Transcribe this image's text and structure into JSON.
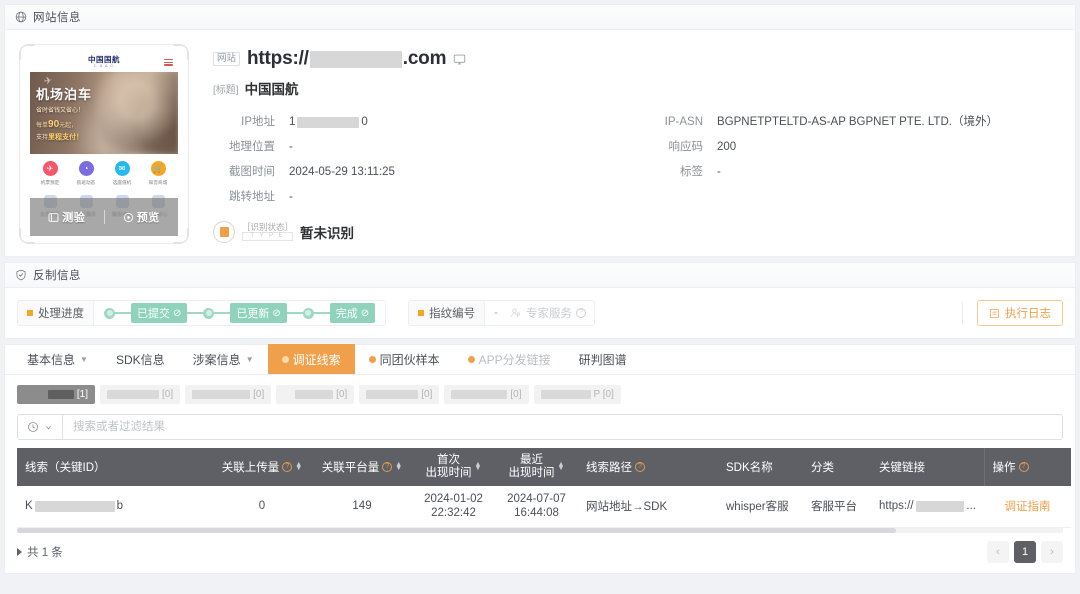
{
  "site_section": {
    "header": {
      "icon": "globe-icon",
      "title": "网站信息"
    },
    "preview": {
      "brand_cn": "中国国航",
      "brand_en": "C A A C",
      "hero_line1": "机场泊车",
      "hero_line2": "省时省钱又省心！",
      "hero_price_prefix": "每单",
      "hero_price": "90",
      "hero_price_suffix": "元起，",
      "hero_line4_prefix": "支持",
      "hero_line4_bold": "里程支付！",
      "quick_items": [
        {
          "label": "机票预定",
          "icon": "plane-icon",
          "color": "#f5566a"
        },
        {
          "label": "航班动态",
          "icon": "clock-icon",
          "color": "#7b6ce0"
        },
        {
          "label": "选座值机",
          "icon": "mail-icon",
          "color": "#29b7ef"
        },
        {
          "label": "知音商城",
          "icon": "cart-icon",
          "color": "#f5a623"
        }
      ],
      "grid_items": [
        {
          "label": "会员专区"
        },
        {
          "label": "旅行服务"
        },
        {
          "label": "服务中心"
        },
        {
          "label": "行李中心"
        }
      ],
      "overlay_buttons": [
        {
          "label": "测验",
          "icon": "scan-icon"
        },
        {
          "label": "预览",
          "icon": "eye-icon"
        }
      ]
    },
    "url_tag": "网站",
    "url_prefix": "https://",
    "url_suffix": ".com",
    "monitor_icon": "monitor-icon",
    "title_tag": "[标题]",
    "title_value": "中国国航",
    "fields_left": [
      {
        "key": "IP地址",
        "value": "1",
        "value_suffix": "0",
        "redacted": true
      },
      {
        "key": "地理位置",
        "value": "-"
      },
      {
        "key": "截图时间",
        "value": "2024-05-29 13:11:25"
      },
      {
        "key": "跳转地址",
        "value": "-"
      }
    ],
    "fields_right": [
      {
        "key": "IP-ASN",
        "value": "BGPNETPTELTD-AS-AP BGPNET PTE. LTD.（境外）"
      },
      {
        "key": "响应码",
        "value": "200"
      },
      {
        "key": "标签",
        "value": "-"
      }
    ],
    "status": {
      "tag_top": "［识别状态］",
      "tag_bottom": "T Y P E",
      "value": "暂未识别",
      "icon": "doc-badge-icon"
    }
  },
  "anti_fraud": {
    "header": {
      "icon": "shield-check-icon",
      "title": "反制信息"
    },
    "progress_label": "处理进度",
    "steps": [
      {
        "label": "已提交",
        "state": "done"
      },
      {
        "label": "已更新",
        "state": "done"
      },
      {
        "label": "完成",
        "state": "done"
      }
    ],
    "fingerprint_label": "指纹编号",
    "fingerprint_value": "-",
    "expert_label": "专家服务",
    "expert_icon": "expert-icon",
    "exec_log_label": "执行日志",
    "exec_log_icon": "log-icon"
  },
  "tabs": [
    {
      "label": "基本信息",
      "caret": true,
      "active": false,
      "muted": false
    },
    {
      "label": "SDK信息",
      "caret": false,
      "active": false,
      "muted": false
    },
    {
      "label": "涉案信息",
      "caret": true,
      "active": false,
      "muted": false
    },
    {
      "label": "调证线索",
      "caret": false,
      "active": true,
      "muted": false,
      "dot": true
    },
    {
      "label": "同团伙样本",
      "caret": false,
      "active": false,
      "muted": false,
      "dot": true
    },
    {
      "label": "APP分发链接",
      "caret": false,
      "active": false,
      "muted": true,
      "dot": true
    },
    {
      "label": "研判图谱",
      "caret": false,
      "active": false,
      "muted": false
    }
  ],
  "subtabs": [
    {
      "label": "[1]",
      "active": true,
      "blob_w": 26
    },
    {
      "label": "[0]",
      "active": false,
      "blob_w": 52
    },
    {
      "label": "[0]",
      "active": false,
      "blob_w": 58
    },
    {
      "label": "[0]",
      "active": false,
      "blob_w": 38
    },
    {
      "label": "[0]",
      "active": false,
      "blob_w": 52
    },
    {
      "label": "[0]",
      "active": false,
      "blob_w": 56
    },
    {
      "label": "P [0]",
      "active": false,
      "blob_w": 50
    }
  ],
  "search": {
    "prefix_icon": "history-icon",
    "caret_icon": "chevron-down-icon",
    "placeholder": "搜索或者过滤结果",
    "value": ""
  },
  "table": {
    "columns": [
      {
        "label": "线索（关键ID）",
        "help": false,
        "sort": false,
        "two_line": false
      },
      {
        "label": "关联上传量",
        "help": true,
        "sort": true,
        "two_line": false
      },
      {
        "label": "关联平台量",
        "help": true,
        "sort": true,
        "two_line": false
      },
      {
        "label_l1": "首次",
        "label_l2": "出现时间",
        "help": false,
        "sort": true,
        "two_line": true
      },
      {
        "label_l1": "最近",
        "label_l2": "出现时间",
        "help": false,
        "sort": true,
        "two_line": true
      },
      {
        "label": "线索路径",
        "help": true,
        "sort": false,
        "two_line": false
      },
      {
        "label": "SDK名称",
        "help": false,
        "sort": false,
        "two_line": false
      },
      {
        "label": "分类",
        "help": false,
        "sort": false,
        "two_line": false
      },
      {
        "label": "关键链接",
        "help": false,
        "sort": false,
        "two_line": false
      },
      {
        "label": "操作",
        "help": true,
        "sort": false,
        "two_line": false
      }
    ],
    "rows": [
      {
        "clue_prefix": "K",
        "clue_suffix": "b",
        "upload_count": "0",
        "platform_count": "149",
        "first_seen_date": "2024-01-02",
        "first_seen_time": "22:32:42",
        "last_seen_date": "2024-07-07",
        "last_seen_time": "16:44:08",
        "path": "网站地址→SDK",
        "sdk_name": "whisper客服",
        "category": "客服平台",
        "link_prefix": "https://",
        "link_suffix": "...",
        "action": "调证指南"
      }
    ]
  },
  "footer": {
    "total_text": "共 1 条",
    "prev": "‹",
    "next": "›",
    "pages": [
      "1"
    ],
    "current_page": "1"
  },
  "colors": {
    "accent_orange": "#f0a04b",
    "step_green": "#8fd3bd",
    "table_head": "#5e6066"
  }
}
